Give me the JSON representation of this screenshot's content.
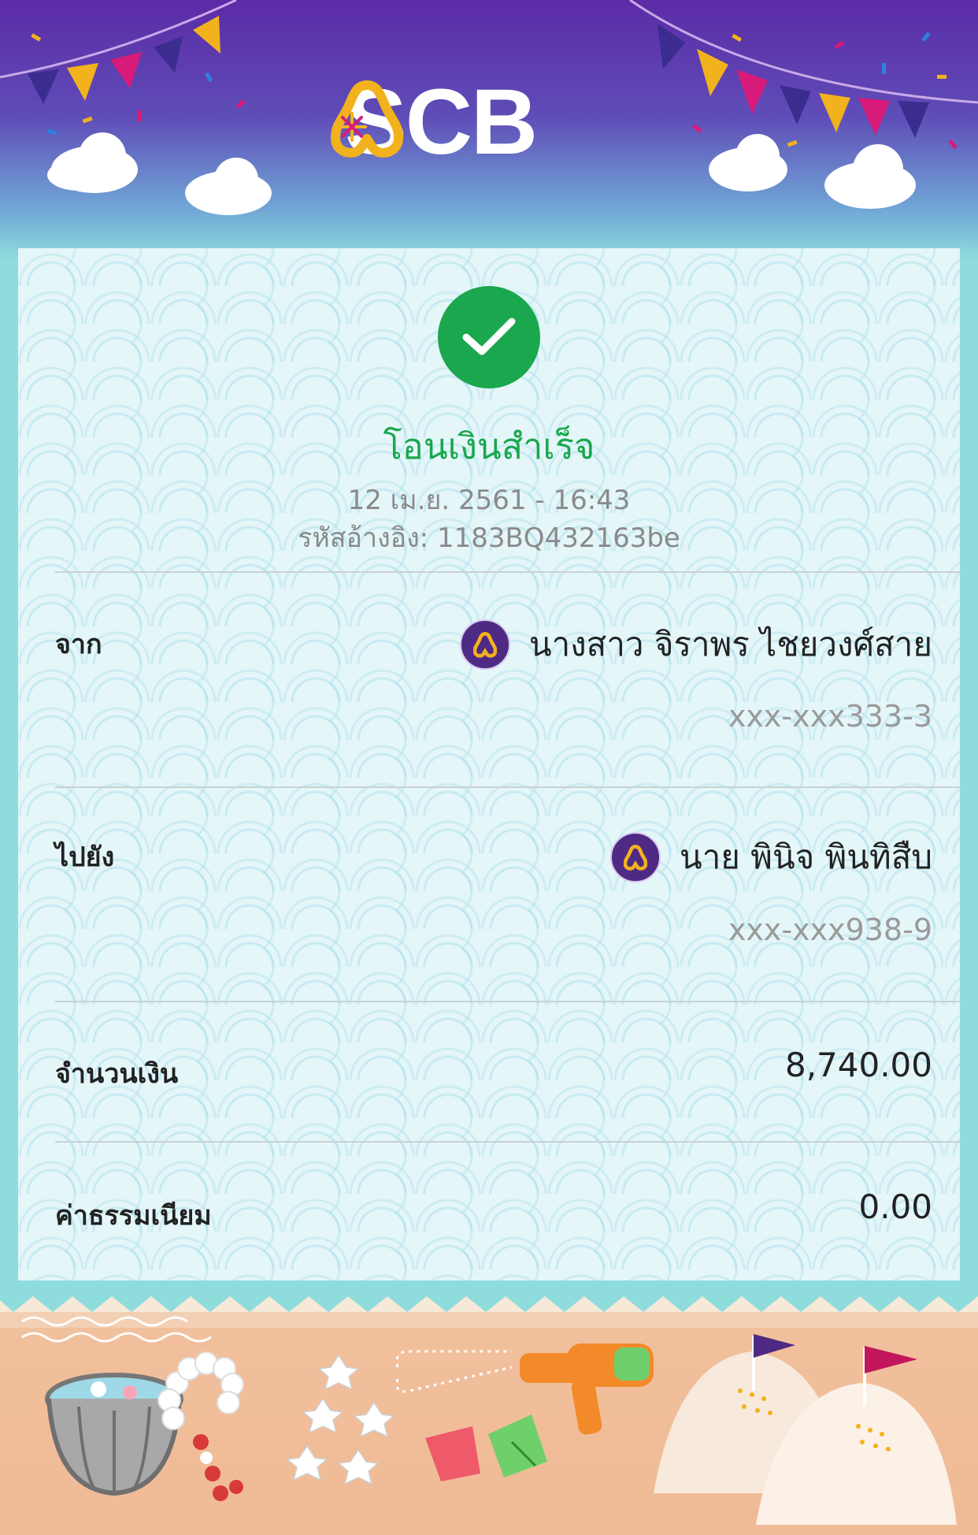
{
  "brand": {
    "name": "SCB"
  },
  "receipt": {
    "status_title": "โอนเงินสำเร็จ",
    "datetime": "12 เม.ย. 2561 - 16:43",
    "reference": "รหัสอ้างอิง: 1183BQ432163be",
    "from": {
      "label": "จาก",
      "name": "นางสาว จิราพร ไชยวงศ์สาย",
      "account": "xxx-xxx333-3"
    },
    "to": {
      "label": "ไปยัง",
      "name": "นาย พินิจ พินทิสืบ",
      "account": "xxx-xxx938-9"
    },
    "amount": {
      "label": "จำนวนเงิน",
      "value": "8,740.00"
    },
    "fee": {
      "label": "ค่าธรรมเนียม",
      "value": "0.00"
    }
  },
  "icons": {
    "success": "check-circle-icon",
    "bank": "scb-bank-icon"
  },
  "colors": {
    "success": "#1aa74e",
    "brand_purple": "#4e2a84",
    "brand_gold": "#f2b21d"
  }
}
